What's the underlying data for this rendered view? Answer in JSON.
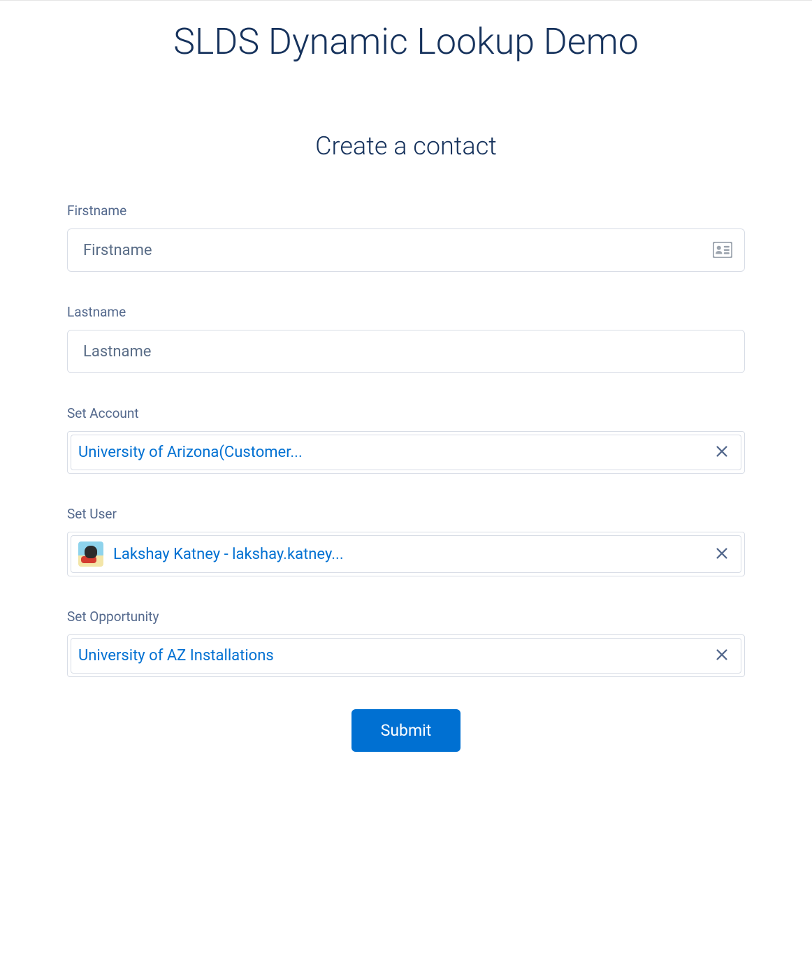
{
  "page": {
    "title": "SLDS Dynamic Lookup Demo",
    "subtitle": "Create a contact"
  },
  "form": {
    "firstname": {
      "label": "Firstname",
      "placeholder": "Firstname",
      "value": ""
    },
    "lastname": {
      "label": "Lastname",
      "placeholder": "Lastname",
      "value": ""
    },
    "account": {
      "label": "Set Account",
      "selected": "University of Arizona(Customer..."
    },
    "user": {
      "label": "Set User",
      "selected": "Lakshay Katney - lakshay.katney..."
    },
    "opportunity": {
      "label": "Set Opportunity",
      "selected": "University of AZ Installations"
    },
    "submit_label": "Submit"
  }
}
